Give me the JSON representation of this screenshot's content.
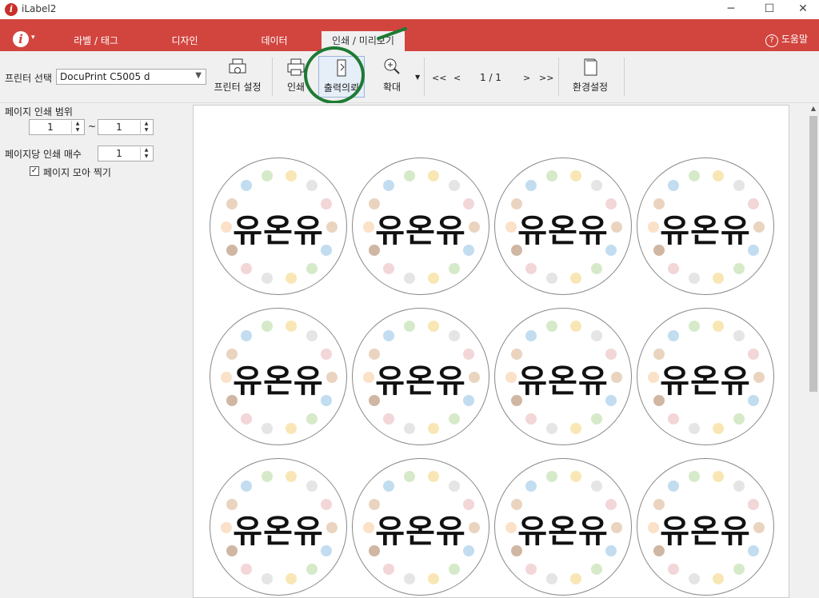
{
  "window": {
    "title": "iLabel2",
    "minimize": "─",
    "maximize": "☐",
    "close": "✕"
  },
  "ribbon": {
    "menu_logo": "i",
    "menu_caret": "▾",
    "tabs": [
      {
        "label": "라벨 / 태그"
      },
      {
        "label": "디자인"
      },
      {
        "label": "데이터"
      },
      {
        "label": "인쇄 / 미리보기"
      }
    ],
    "help_label": "도움말"
  },
  "toolbar": {
    "printer_select_label": "프린터 선택",
    "printer_value": "DocuPrint C5005 d",
    "printer_setup": "프린터 설정",
    "print": "인쇄",
    "print_request": "출력의뢰",
    "zoom": "확대",
    "nav_first": "<<",
    "nav_prev": "<",
    "page_indicator": "1 / 1",
    "nav_next": ">",
    "nav_last": ">>",
    "settings": "환경설정"
  },
  "sidebar": {
    "range_label": "페이지 인쇄 범위",
    "range_from": "1",
    "range_sep": "~",
    "range_to": "1",
    "copies_label": "페이지당 인쇄 매수",
    "copies_value": "1",
    "collate_label": "페이지 모아 찍기",
    "collate_checked": true
  },
  "preview": {
    "label_text": "유온유",
    "rows": 3,
    "cols": 4
  },
  "colors": {
    "accent": "#d2453f",
    "highlight": "#1e7a34"
  }
}
